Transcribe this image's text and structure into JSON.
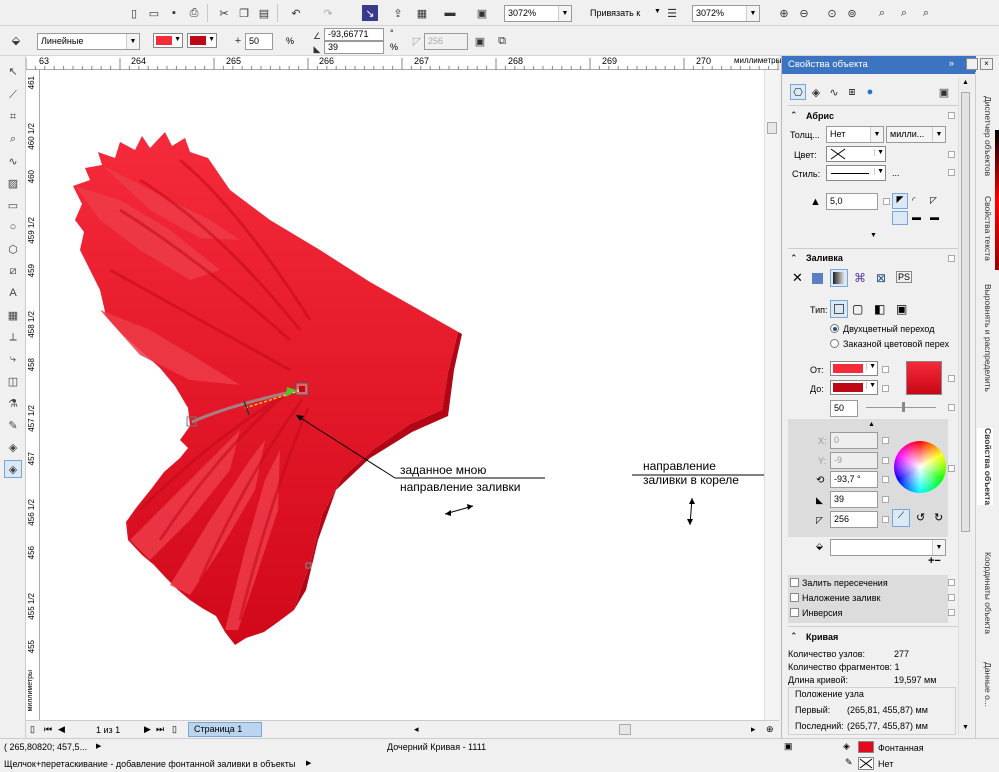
{
  "toolbar": {
    "zoom1": "3072%",
    "snap_label": "Привязать к",
    "zoom2": "3072%"
  },
  "propbar": {
    "line_type": "Линейные",
    "midpoint": "50",
    "percent": "%",
    "angle": "-93,66771",
    "degree": "°",
    "edge_pad": "39",
    "steps": "256"
  },
  "ruler": {
    "top_ticks": [
      "63",
      "264",
      "265",
      "266",
      "267",
      "268",
      "269",
      "270"
    ],
    "unit": "миллиметры",
    "left_ticks": [
      "461",
      "460 1/2",
      "460",
      "459 1/2",
      "459",
      "458 1/2",
      "458",
      "457 1/2",
      "457",
      "456 1/2",
      "456",
      "455 1/2",
      "455"
    ],
    "left_unit": "миллиметры"
  },
  "canvas": {
    "annot1_line1": "заданное мною",
    "annot1_line2": "направление заливки",
    "annot2_line1": "направление",
    "annot2_line2": "заливки в кореле"
  },
  "pagebar": {
    "page_count": "1 из 1",
    "page_tab": "Страница 1"
  },
  "status": {
    "coords": "( 265,80820; 457,5...",
    "object_info": "Дочерний Кривая - 1111",
    "hint": "Щелчок+перетаскивание - добавление фонтанной заливки в объекты",
    "fill_label": "Фонтанная",
    "outline_label": "Нет"
  },
  "panel": {
    "title": "Свойства объекта",
    "outline": {
      "title": "Абрис",
      "width_label": "Толщ...",
      "width_value": "Нет",
      "units": "милли...",
      "color_label": "Цвет:",
      "style_label": "Стиль:",
      "miter": "5,0"
    },
    "fill": {
      "title": "Заливка",
      "type_label": "Тип:",
      "option1": "Двухцветный переход",
      "option2": "Заказной цветовой перех",
      "from_label": "От:",
      "to_label": "До:",
      "mid": "50",
      "x_label": "X:",
      "x_value": "0",
      "y_label": "Y:",
      "y_value": "-9",
      "angle": "-93,7 °",
      "pad": "39",
      "steps": "256",
      "cb1": "Залить пересечения",
      "cb2": "Наложение заливк",
      "cb3": "Инверсия"
    },
    "curve": {
      "title": "Кривая",
      "nodes_label": "Количество узлов:",
      "nodes_value": "277",
      "frags_label": "Количество фрагментов: 1",
      "length_label": "Длина кривой:",
      "length_value": "19,597 мм",
      "pos_label": "Положение узла",
      "first_label": "Первый:",
      "first_value": "(265,81, 455,87) мм",
      "last_label": "Последний:",
      "last_value": "(265,77, 455,87) мм"
    }
  },
  "side_tabs": [
    "Диспетчер объектов",
    "Свойства текста",
    "Выровнять и распределить",
    "Свойства объекта",
    "Координаты объекта",
    "Данные о..."
  ],
  "colors": {
    "fill_from": "#f52a3a",
    "fill_to": "#d1081a",
    "petal_light": "#ef3b49",
    "petal_dark": "#d60f1e"
  }
}
